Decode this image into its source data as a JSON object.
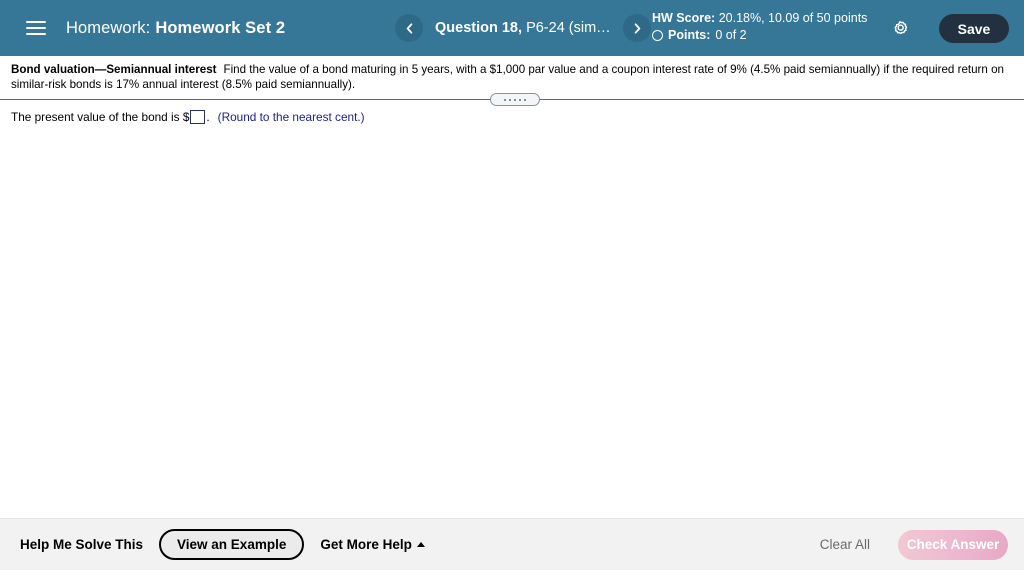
{
  "header": {
    "menu_icon": "hamburger-icon",
    "course_label": "Homework:",
    "assignment_title": "Homework Set 2",
    "prev_icon": "chevron-left-icon",
    "next_icon": "chevron-right-icon",
    "question_number": "Question 18,",
    "question_ref": "P6-24 (simil...",
    "hw_score_label": "HW Score:",
    "hw_score_value": "20.18%, 10.09 of 50 points",
    "points_label": "Points:",
    "points_value": "0 of 2",
    "settings_icon": "gear-icon",
    "save_label": "Save",
    "bg_color": "#367696",
    "save_bg_color": "#22303f"
  },
  "question": {
    "title": "Bond valuation—Semiannual interest",
    "body": "Find the value of a bond maturing in 5 years, with a $1,000 par value and a coupon interest rate of 9% (4.5% paid semiannually) if the required return on similar-risk bonds is 17% annual interest (8.5% paid semiannually)."
  },
  "answer": {
    "prompt_prefix": "The present value of the bond is $",
    "input_value": "",
    "input_placeholder": "",
    "prompt_suffix": ".",
    "round_note": "(Round to the nearest cent.)",
    "note_color": "#1b1f8a"
  },
  "bottom_bar": {
    "help_me_solve": "Help Me Solve This",
    "view_example": "View an Example",
    "get_more_help": "Get More Help",
    "more_help_icon": "caret-up-icon",
    "clear_all": "Clear All",
    "check_answer": "Check Answer",
    "check_answer_color": "#eeb9cf"
  }
}
